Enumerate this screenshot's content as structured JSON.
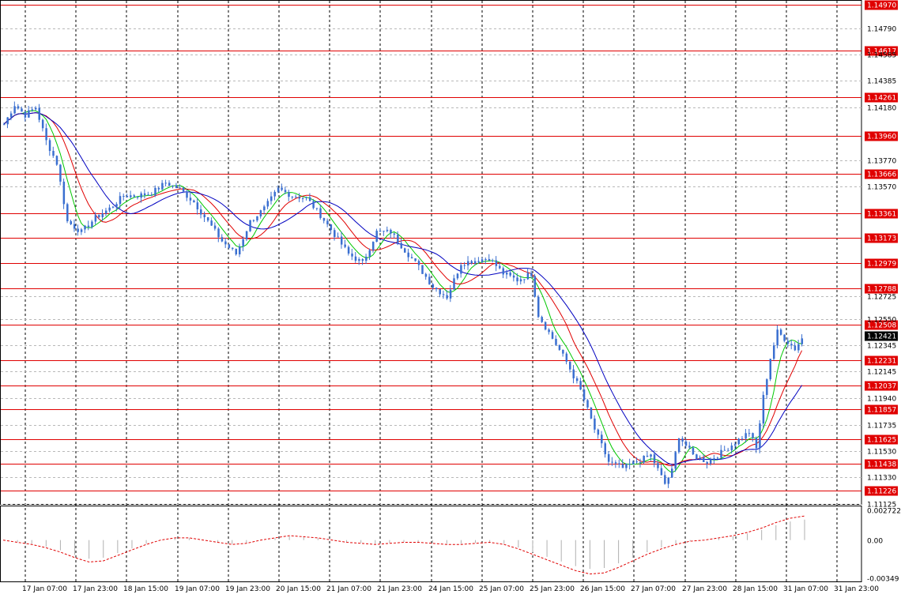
{
  "chart_data": [
    {
      "type": "candlestick",
      "title": "",
      "yrange": [
        1.11125,
        1.1497
      ],
      "price_ticks": [
        "1.14790",
        "1.14585",
        "1.14385",
        "1.14180",
        "1.13770",
        "1.13570",
        "1.12725",
        "1.12550",
        "1.12345",
        "1.12145",
        "1.11940",
        "1.11735",
        "1.11530",
        "1.11330",
        "1.11125"
      ],
      "horizontal_levels": [
        "1.14970",
        "1.14617",
        "1.14261",
        "1.13960",
        "1.13666",
        "1.13361",
        "1.13173",
        "1.12979",
        "1.12788",
        "1.12508",
        "1.12231",
        "1.12037",
        "1.11857",
        "1.11625",
        "1.11438",
        "1.11226"
      ],
      "current_price": "1.12421",
      "time_labels": [
        "17 Jan 07:00",
        "17 Jan 23:00",
        "18 Jan 15:00",
        "19 Jan 07:00",
        "19 Jan 23:00",
        "20 Jan 15:00",
        "21 Jan 07:00",
        "21 Jan 23:00",
        "24 Jan 15:00",
        "25 Jan 07:00",
        "25 Jan 23:00",
        "26 Jan 15:00",
        "27 Jan 07:00",
        "27 Jan 23:00",
        "28 Jan 15:00",
        "31 Jan 07:00",
        "31 Jan 23:00"
      ],
      "series": [
        {
          "role": "price",
          "color": "#3a6fd0"
        },
        {
          "role": "ma-fast",
          "color": "#00c800"
        },
        {
          "role": "ma-mid",
          "color": "#e00000"
        },
        {
          "role": "ma-slow",
          "color": "#0000c0"
        }
      ],
      "price_anchors": [
        [
          0,
          1.1405
        ],
        [
          3,
          1.142
        ],
        [
          6,
          1.1412
        ],
        [
          9,
          1.1418
        ],
        [
          12,
          1.1392
        ],
        [
          15,
          1.1375
        ],
        [
          18,
          1.133
        ],
        [
          22,
          1.1322
        ],
        [
          26,
          1.1333
        ],
        [
          30,
          1.134
        ],
        [
          34,
          1.135
        ],
        [
          38,
          1.135
        ],
        [
          42,
          1.1352
        ],
        [
          46,
          1.136
        ],
        [
          50,
          1.1355
        ],
        [
          54,
          1.1345
        ],
        [
          58,
          1.133
        ],
        [
          62,
          1.1315
        ],
        [
          66,
          1.1305
        ],
        [
          70,
          1.133
        ],
        [
          74,
          1.134
        ],
        [
          78,
          1.1355
        ],
        [
          82,
          1.135
        ],
        [
          86,
          1.1348
        ],
        [
          90,
          1.1335
        ],
        [
          94,
          1.132
        ],
        [
          98,
          1.1305
        ],
        [
          102,
          1.1298
        ],
        [
          106,
          1.1322
        ],
        [
          110,
          1.1322
        ],
        [
          114,
          1.1308
        ],
        [
          118,
          1.1295
        ],
        [
          122,
          1.128
        ],
        [
          126,
          1.1272
        ],
        [
          130,
          1.1298
        ],
        [
          134,
          1.13
        ],
        [
          138,
          1.1302
        ],
        [
          142,
          1.129
        ],
        [
          146,
          1.1285
        ],
        [
          150,
          1.129
        ],
        [
          152,
          1.1258
        ],
        [
          156,
          1.124
        ],
        [
          160,
          1.1222
        ],
        [
          164,
          1.12
        ],
        [
          168,
          1.117
        ],
        [
          172,
          1.1145
        ],
        [
          176,
          1.114
        ],
        [
          180,
          1.1145
        ],
        [
          184,
          1.115
        ],
        [
          188,
          1.1128
        ],
        [
          190,
          1.1138
        ],
        [
          192,
          1.1165
        ],
        [
          196,
          1.115
        ],
        [
          200,
          1.1145
        ],
        [
          204,
          1.1152
        ],
        [
          208,
          1.116
        ],
        [
          212,
          1.1168
        ],
        [
          214,
          1.1155
        ],
        [
          216,
          1.1195
        ],
        [
          218,
          1.1225
        ],
        [
          220,
          1.1245
        ],
        [
          222,
          1.124
        ],
        [
          225,
          1.1232
        ],
        [
          227,
          1.124
        ]
      ],
      "oscillator": {
        "ticks": [
          "0.002722",
          "0.00",
          "-0.00349"
        ],
        "range": [
          -0.00349,
          0.002722
        ],
        "values": [
          0.0,
          -0.0002,
          -0.0004,
          -0.0007,
          -0.0011,
          -0.0016,
          -0.002,
          -0.0019,
          -0.0014,
          -0.0009,
          -0.0004,
          0.0,
          0.0002,
          0.0002,
          0.0,
          -0.0002,
          -0.0004,
          -0.0003,
          0.0,
          0.0002,
          0.0004,
          0.0003,
          0.0002,
          0.0,
          -0.0002,
          -0.0003,
          -0.0004,
          -0.0003,
          -0.0002,
          -0.0002,
          -0.0003,
          -0.0004,
          -0.0004,
          -0.0003,
          -0.0002,
          -0.0004,
          -0.0008,
          -0.0013,
          -0.0018,
          -0.0023,
          -0.0028,
          -0.0031,
          -0.003,
          -0.0025,
          -0.0019,
          -0.0013,
          -0.0008,
          -0.0004,
          -0.0001,
          0.0,
          0.0002,
          0.0004,
          0.0007,
          0.0011,
          0.0016,
          0.002,
          0.0022
        ]
      }
    }
  ]
}
